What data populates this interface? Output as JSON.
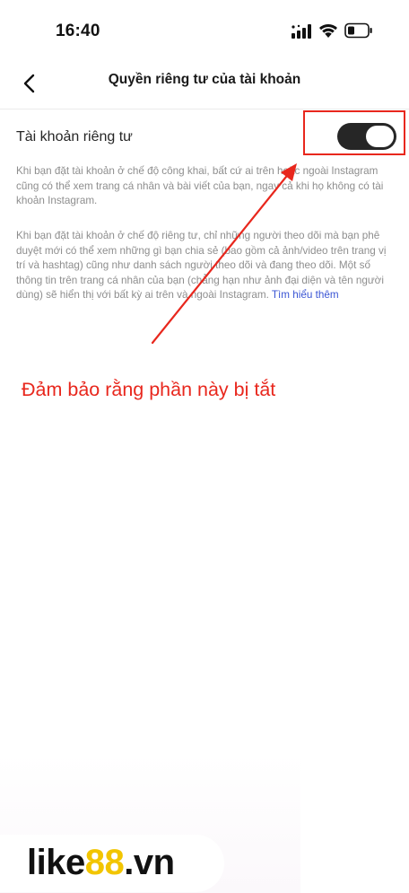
{
  "status_bar": {
    "time": "16:40",
    "icons": [
      "signal-icon",
      "wifi-icon",
      "battery-icon"
    ]
  },
  "header": {
    "back_icon": "chevron-left-icon",
    "title": "Quyền riêng tư của tài khoản"
  },
  "private_account": {
    "label": "Tài khoản riêng tư",
    "toggle_on": true
  },
  "descriptions": {
    "public_text": "Khi bạn đặt tài khoản ở chế độ công khai, bất cứ ai trên hoặc ngoài Instagram cũng có thể xem trang cá nhân và bài viết của bạn, ngay cả khi họ không có tài khoản Instagram.",
    "private_text": "Khi bạn đặt tài khoản ở chế độ riêng tư, chỉ những người theo dõi mà bạn phê duyệt mới có thể xem những gì bạn chia sẻ (bao gồm cả ảnh/video trên trang vị trí và hashtag) cũng như danh sách người theo dõi và đang theo dõi. Một số thông tin trên trang cá nhân của bạn (chẳng hạn như ảnh đại diện và tên người dùng) sẽ hiển thị với bất kỳ ai trên và ngoài Instagram.",
    "learn_more": "Tìm hiểu thêm"
  },
  "annotation": {
    "text": "Đảm bảo rằng phần này bị tắt",
    "color": "#e8271d"
  },
  "watermark": {
    "part1": "like",
    "part2": "88",
    "part3": ".vn",
    "accent_color": "#f2c500"
  },
  "colors": {
    "toggle_track": "#262626",
    "link": "#3a55d4",
    "secondary_text": "#8e8e8e"
  }
}
